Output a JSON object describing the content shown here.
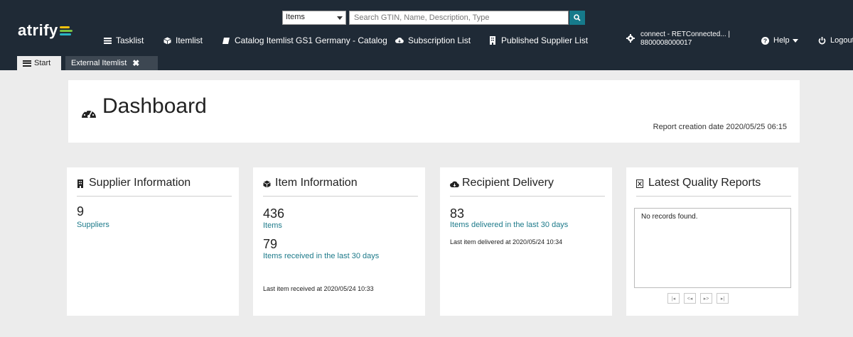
{
  "brand": {
    "logo": "atrify"
  },
  "search": {
    "type_value": "Items",
    "placeholder": "Search GTIN, Name, Description, Type"
  },
  "nav": {
    "tasklist": "Tasklist",
    "itemlist": "Itemlist",
    "catalog": "Catalog Itemlist GS1 Germany - Catalog",
    "subscription": "Subscription List",
    "published": "Published Supplier List",
    "help": "Help",
    "logout": "Logout"
  },
  "user": {
    "line1": "connect - RETConnected... |",
    "line2": "8800008000017"
  },
  "tabs": {
    "start": "Start",
    "external": "External Itemlist"
  },
  "dashboard": {
    "title": "Dashboard",
    "report_date": "Report creation date 2020/05/25 06:15"
  },
  "cards": {
    "supplier": {
      "title": "Supplier Information",
      "count": "9",
      "count_label": "Suppliers"
    },
    "item": {
      "title": "Item Information",
      "count": "436",
      "count_label": "Items",
      "recent": "79",
      "recent_label": "Items received in the last 30 days",
      "last": "Last item received at 2020/05/24 10:33"
    },
    "recipient": {
      "title": "Recipient Delivery",
      "count": "83",
      "count_label": "Items delivered in the last 30 days",
      "last": "Last item delivered at 2020/05/24 10:34"
    },
    "quality": {
      "title": "Latest Quality Reports",
      "empty": "No records found."
    }
  },
  "colors": {
    "header": "#1f2a36",
    "accent": "#167a8b",
    "link": "#1d7a8a",
    "background": "#ececec"
  }
}
